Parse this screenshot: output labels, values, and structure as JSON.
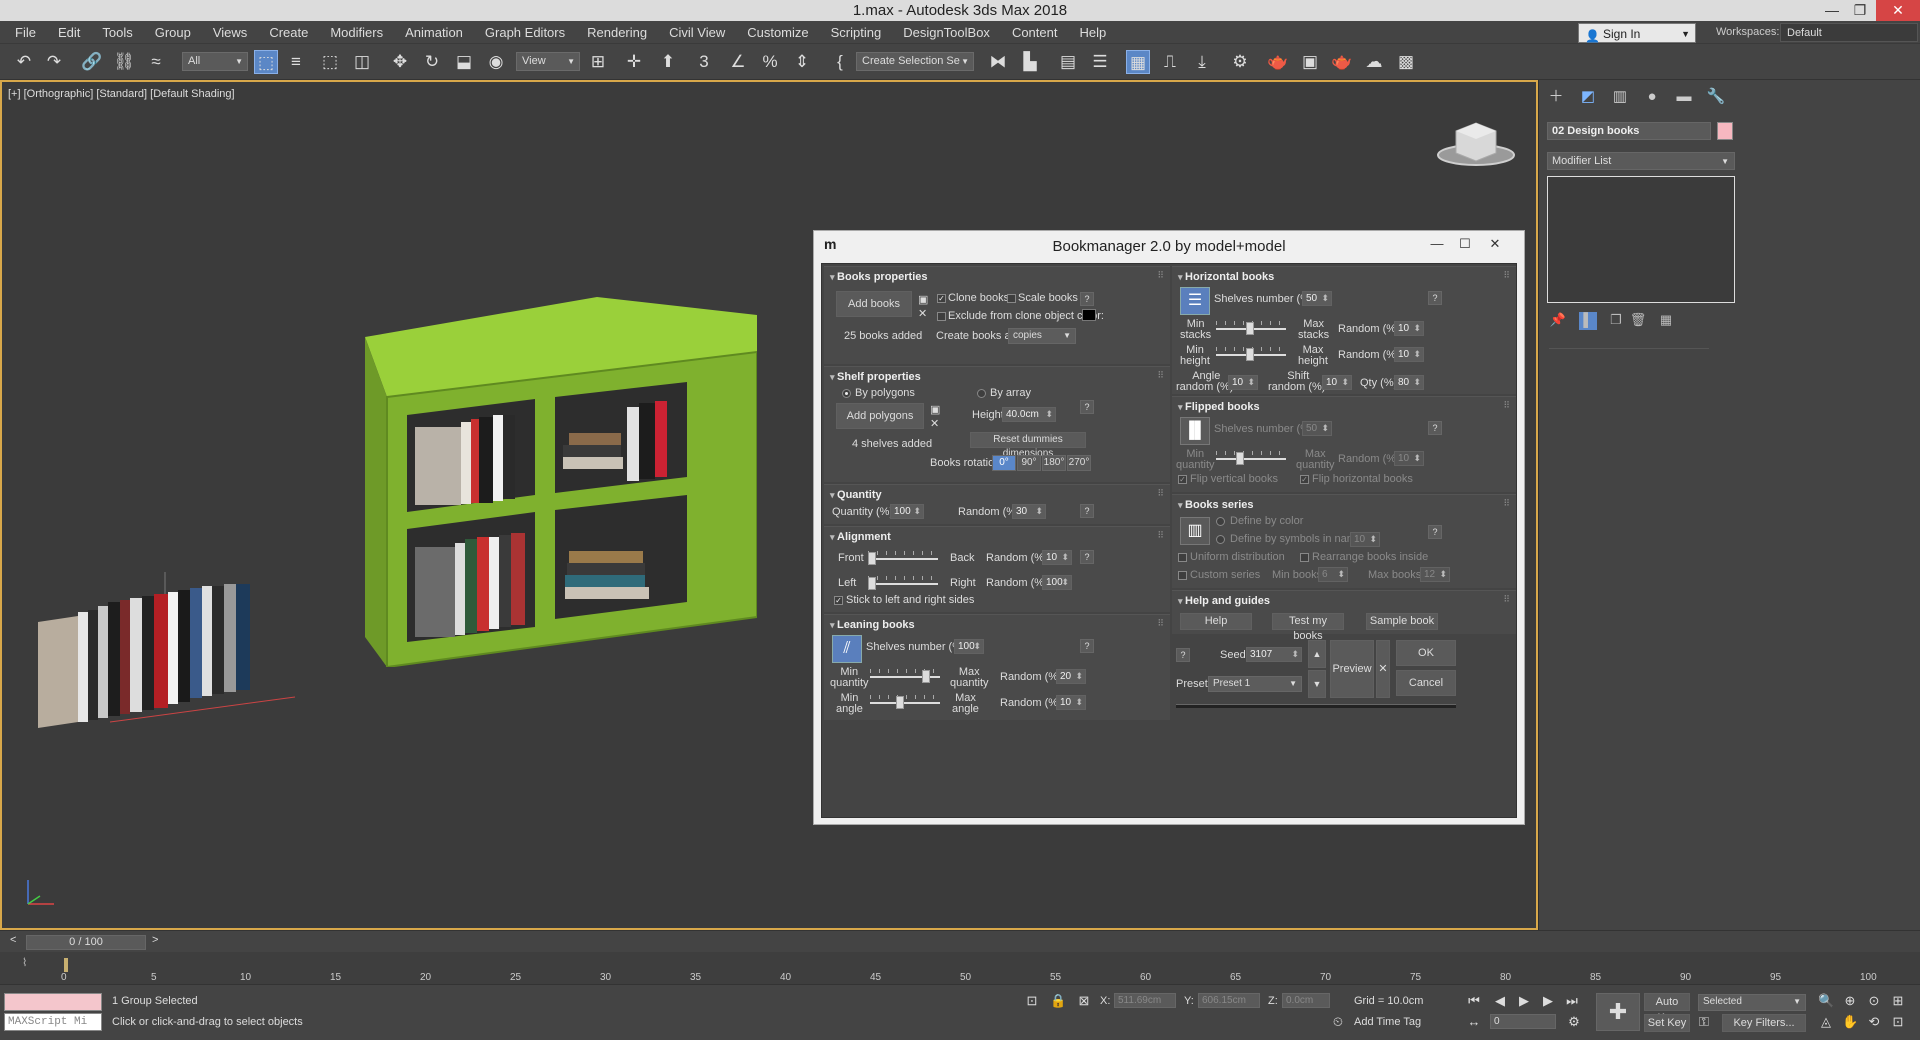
{
  "window": {
    "title": "1.max - Autodesk 3ds Max 2018",
    "controls": [
      "—",
      "❐",
      "✕"
    ]
  },
  "menu": [
    "File",
    "Edit",
    "Tools",
    "Group",
    "Views",
    "Create",
    "Modifiers",
    "Animation",
    "Graph Editors",
    "Rendering",
    "Civil View",
    "Customize",
    "Scripting",
    "DesignToolBox",
    "Content",
    "Help"
  ],
  "signin": {
    "label": "Sign In",
    "icon": "user-icon"
  },
  "workspaces": {
    "label": "Workspaces:",
    "value": "Default"
  },
  "toolbar": {
    "filter": "All",
    "view": "View",
    "selection_set": "Create Selection Se"
  },
  "viewport": {
    "label": "[+] [Orthographic] [Standard] [Default Shading]"
  },
  "command_panel": {
    "object_name": "02 Design books",
    "object_color": "#f7b8c0",
    "modifier_list": "Modifier List"
  },
  "dialog": {
    "logo": "m",
    "title": "Bookmanager 2.0 by model+model",
    "books_properties": {
      "header": "Books properties",
      "add_books": "Add books",
      "clone_books": "Clone books",
      "scale_books": "Scale books",
      "exclude": "Exclude from clone object color:",
      "count": "25 books added",
      "create_as_label": "Create books as:",
      "create_as_value": "copies"
    },
    "shelf_properties": {
      "header": "Shelf properties",
      "by_polygons": "By polygons",
      "by_array": "By array",
      "add_polygons": "Add polygons",
      "height_label": "Height:",
      "height_value": "40.0cm",
      "reset": "Reset dummies dimensions",
      "count": "4 shelves added",
      "rotation_label": "Books rotation:",
      "rotations": [
        "0°",
        "90°",
        "180°",
        "270°"
      ]
    },
    "quantity": {
      "header": "Quantity",
      "qty_label": "Quantity (%):",
      "qty_value": "100",
      "random_label": "Random (%)",
      "random_value": "30"
    },
    "alignment": {
      "header": "Alignment",
      "front": "Front",
      "back": "Back",
      "left": "Left",
      "right": "Right",
      "random1_label": "Random (%):",
      "random1_value": "10",
      "random2_label": "Random (%):",
      "random2_value": "100",
      "stick": "Stick to left and right sides"
    },
    "leaning_books": {
      "header": "Leaning books",
      "shelves_label": "Shelves number (%):",
      "shelves_value": "100",
      "min_qty": "Min\nquantity",
      "max_qty": "Max\nquantity",
      "random1_label": "Random (%):",
      "random1_value": "20",
      "min_angle": "Min\nangle",
      "max_angle": "Max\nangle",
      "random2_label": "Random (%):",
      "random2_value": "10"
    },
    "horizontal_books": {
      "header": "Horizontal books",
      "shelves_label": "Shelves number (%):",
      "shelves_value": "50",
      "min_stacks": "Min\nstacks",
      "max_stacks": "Max\nstacks",
      "random1_label": "Random (%):",
      "random1_value": "10",
      "min_height": "Min\nheight",
      "max_height": "Max\nheight",
      "random2_label": "Random (%):",
      "random2_value": "10",
      "angle_random": "Angle\nrandom (%):",
      "angle_random_value": "10",
      "shift_random": "Shift\nrandom (%):",
      "shift_random_value": "10",
      "qty_label": "Qty (%):",
      "qty_value": "80"
    },
    "flipped_books": {
      "header": "Flipped books",
      "shelves_label": "Shelves number (%):",
      "shelves_value": "50",
      "min_qty": "Min\nquantity",
      "max_qty": "Max\nquantity",
      "random_label": "Random (%):",
      "random_value": "10",
      "flip_vertical": "Flip vertical books",
      "flip_horizontal": "Flip horizontal books"
    },
    "books_series": {
      "header": "Books series",
      "define_color": "Define by color",
      "define_symbols": "Define by symbols in name:",
      "symbols_value": "10",
      "uniform": "Uniform distribution",
      "rearrange": "Rearrange books inside",
      "custom": "Custom series",
      "min_books_label": "Min books:",
      "min_books_value": "6",
      "max_books_label": "Max books:",
      "max_books_value": "12"
    },
    "help_guides": {
      "header": "Help and guides",
      "help": "Help",
      "test": "Test my books",
      "sample": "Sample book"
    },
    "footer": {
      "seed_label": "Seed:",
      "seed_value": "3107",
      "preset_label": "Preset:",
      "preset_value": "Preset 1",
      "preview": "Preview",
      "ok": "OK",
      "cancel": "Cancel"
    }
  },
  "timeline": {
    "frame": "0 / 100",
    "ticks": [
      "0",
      "5",
      "10",
      "15",
      "20",
      "25",
      "30",
      "35",
      "40",
      "45",
      "50",
      "55",
      "60",
      "65",
      "70",
      "75",
      "80",
      "85",
      "90",
      "95",
      "100"
    ]
  },
  "status": {
    "maxscript": "MAXScript Mi",
    "selection": "1 Group Selected",
    "prompt": "Click or click-and-drag to select objects",
    "x_label": "X:",
    "x_value": "511.69cm",
    "y_label": "Y:",
    "y_value": "606.15cm",
    "z_label": "Z:",
    "z_value": "0.0cm",
    "grid": "Grid = 10.0cm",
    "add_time_tag": "Add Time Tag",
    "auto_key": "Auto Key",
    "set_key": "Set Key",
    "selected": "Selected",
    "key_filters": "Key Filters...",
    "frame_field": "0"
  }
}
